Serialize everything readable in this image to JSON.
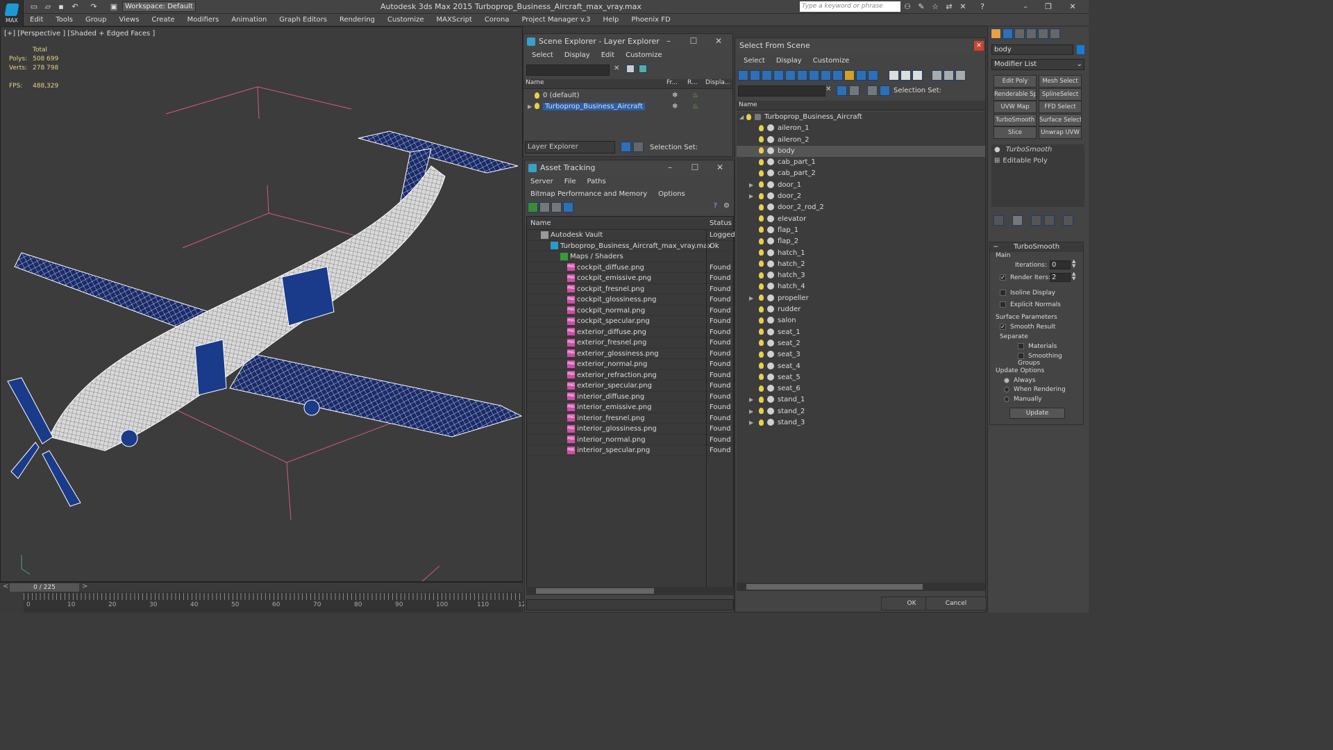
{
  "app": {
    "logo_text": "MAX",
    "workspace": "Workspace: Default",
    "title": "Autodesk 3ds Max  2015     Turboprop_Business_Aircraft_max_vray.max",
    "search_placeholder": "Type a keyword or phrase"
  },
  "menu": [
    "Edit",
    "Tools",
    "Group",
    "Views",
    "Create",
    "Modifiers",
    "Animation",
    "Graph Editors",
    "Rendering",
    "Customize",
    "MAXScript",
    "Corona",
    "Project Manager v.3",
    "Help",
    "Phoenix FD"
  ],
  "viewport": {
    "label": "[+] [Perspective ] [Shaded + Edged Faces ]",
    "stats": {
      "total_label": "Total",
      "polys_label": "Polys:",
      "polys": "508 699",
      "verts_label": "Verts:",
      "verts": "278 798",
      "fps_label": "FPS:",
      "fps": "488,329"
    }
  },
  "scene_explorer": {
    "title": "Scene Explorer - Layer Explorer",
    "menu": [
      "Select",
      "Display",
      "Edit",
      "Customize"
    ],
    "columns": [
      "Name",
      "Fr...",
      "R...",
      "Displa..."
    ],
    "rows": [
      "0 (default)",
      "Turboprop_Business_Aircraft"
    ],
    "footer_dropdown": "Layer Explorer",
    "selection_set_label": "Selection Set:"
  },
  "asset_tracking": {
    "title": "Asset Tracking",
    "menu": [
      "Server",
      "File",
      "Paths",
      "Bitmap Performance and Memory",
      "Options"
    ],
    "columns": {
      "name": "Name",
      "status": "Status"
    },
    "rows": [
      {
        "name": "Autodesk Vault",
        "status": "Logged"
      },
      {
        "name": "Turboprop_Business_Aircraft_max_vray.max",
        "status": "Ok"
      },
      {
        "name": "Maps / Shaders",
        "status": ""
      },
      {
        "name": "cockpit_diffuse.png",
        "status": "Found"
      },
      {
        "name": "cockpit_emissive.png",
        "status": "Found"
      },
      {
        "name": "cockpit_fresnel.png",
        "status": "Found"
      },
      {
        "name": "cockpit_glossiness.png",
        "status": "Found"
      },
      {
        "name": "cockpit_normal.png",
        "status": "Found"
      },
      {
        "name": "cockpit_specular.png",
        "status": "Found"
      },
      {
        "name": "exterior_diffuse.png",
        "status": "Found"
      },
      {
        "name": "exterior_fresnel.png",
        "status": "Found"
      },
      {
        "name": "exterior_glossiness.png",
        "status": "Found"
      },
      {
        "name": "exterior_normal.png",
        "status": "Found"
      },
      {
        "name": "exterior_refraction.png",
        "status": "Found"
      },
      {
        "name": "exterior_specular.png",
        "status": "Found"
      },
      {
        "name": "interior_diffuse.png",
        "status": "Found"
      },
      {
        "name": "interior_emissive.png",
        "status": "Found"
      },
      {
        "name": "interior_fresnel.png",
        "status": "Found"
      },
      {
        "name": "interior_glossiness.png",
        "status": "Found"
      },
      {
        "name": "interior_normal.png",
        "status": "Found"
      },
      {
        "name": "interior_specular.png",
        "status": "Found"
      }
    ]
  },
  "select_from_scene": {
    "title": "Select From Scene",
    "menu": [
      "Select",
      "Display",
      "Customize"
    ],
    "selection_set_label": "Selection Set:",
    "column": "Name",
    "root": "Turboprop_Business_Aircraft",
    "items": [
      "aileron_1",
      "aileron_2",
      "body",
      "cab_part_1",
      "cab_part_2",
      "door_1",
      "door_2",
      "door_2_rod_2",
      "elevator",
      "flap_1",
      "flap_2",
      "hatch_1",
      "hatch_2",
      "hatch_3",
      "hatch_4",
      "propeller",
      "rudder",
      "salon",
      "seat_1",
      "seat_2",
      "seat_3",
      "seat_4",
      "seat_5",
      "seat_6",
      "stand_1",
      "stand_2",
      "stand_3"
    ],
    "ok": "OK",
    "cancel": "Cancel"
  },
  "command_panel": {
    "object_name": "body",
    "modifier_list": "Modifier List",
    "buttons": [
      "Edit Poly",
      "Mesh Select",
      "Renderable Spline",
      "SplineSelect",
      "UVW Map",
      "FFD Select",
      "TurboSmooth",
      "Surface Select",
      "Slice",
      "Unwrap UVW"
    ],
    "stack": [
      "TurboSmooth",
      "Editable Poly"
    ],
    "turbosmooth": {
      "title": "TurboSmooth",
      "main": "Main",
      "iterations_label": "Iterations:",
      "iterations": "0",
      "render_iters_label": "Render Iters:",
      "render_iters": "2",
      "isoline": "Isoline Display",
      "explicit_normals": "Explicit Normals",
      "surface_params": "Surface Parameters",
      "smooth_result": "Smooth Result",
      "separate": "Separate",
      "materials": "Materials",
      "smoothing_groups": "Smoothing Groups",
      "update_options": "Update Options",
      "always": "Always",
      "when_rendering": "When Rendering",
      "manually": "Manually",
      "update": "Update"
    }
  },
  "timeline": {
    "frame": "0 / 225",
    "ticks": [
      "0",
      "10",
      "20",
      "30",
      "40",
      "50",
      "60",
      "70",
      "80",
      "90",
      "100",
      "110",
      "12"
    ]
  },
  "colors": {
    "accent": "#1b9ad6",
    "selection": "#2a5ea8",
    "wire": "#ffffff",
    "grid": "#d45a8a"
  }
}
